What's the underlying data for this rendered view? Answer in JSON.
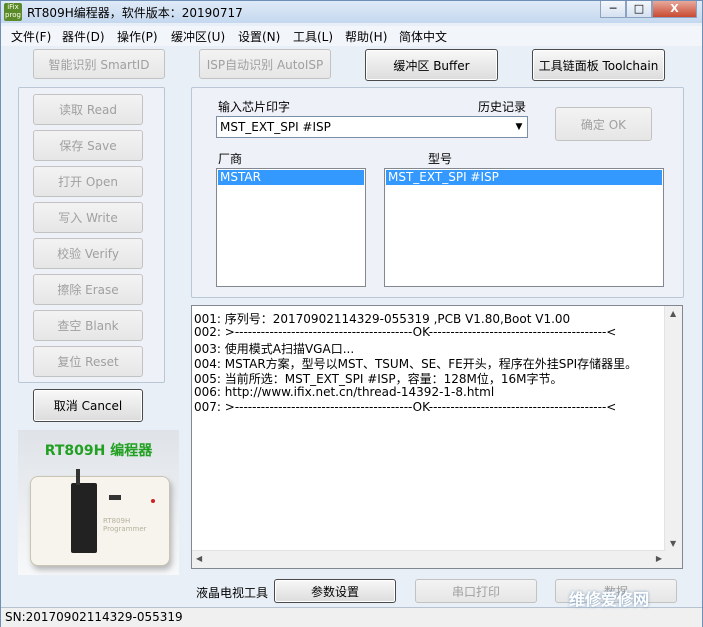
{
  "window": {
    "title": "RT809H编程器，软件版本：20190717",
    "icon_text": "iFix prog",
    "controls": [
      "─",
      "□",
      "X"
    ]
  },
  "menu": [
    "文件(F)",
    "器件(D)",
    "操作(P)",
    "缓冲区(U)",
    "设置(N)",
    "工具(L)",
    "帮助(H)",
    "简体中文"
  ],
  "top_buttons": {
    "smartid": "智能识别 SmartID",
    "autoisp": "ISP自动识别 AutoISP",
    "buffer": "缓冲区 Buffer",
    "toolchain": "工具链面板 Toolchain"
  },
  "operations": [
    "读取 Read",
    "保存 Save",
    "打开 Open",
    "写入 Write",
    "校验 Verify",
    "擦除 Erase",
    "查空 Blank",
    "复位 Reset"
  ],
  "cancel_label": "取消 Cancel",
  "chip": {
    "input_label": "输入芯片印字",
    "history_label": "历史记录",
    "input_value": "MST_EXT_SPI #ISP",
    "ok_label": "确定 OK",
    "vendor_label": "厂商",
    "model_label": "型号",
    "vendor_selected": "MSTAR",
    "model_selected": "MST_EXT_SPI #ISP"
  },
  "log_lines": [
    "001: 序列号：20170902114329-055319 ,PCB V1.80,Boot V1.00",
    "002: >-----------------------------------------OK-----------------------------------------<",
    "003: 使用模式A扫描VGA口...",
    "004: MSTAR方案，型号以MST、TSUM、SE、FE开头，程序在外挂SPI存储器里。",
    "005: 当前所选：MST_EXT_SPI #ISP，容量：128M位，16M字节。",
    "006: http://www.ifix.net.cn/thread-14392-1-8.html",
    "007: >-----------------------------------------OK-----------------------------------------<"
  ],
  "photo": {
    "caption": "RT809H 编程器",
    "device_text": "RT809H Programmer"
  },
  "bottom": {
    "lcd_tools_label": "液晶电视工具",
    "params_label": "参数设置",
    "serial_print_label": "串口打印",
    "partial_button_label": "数据"
  },
  "status": {
    "serial": "SN:20170902114329-055319"
  },
  "watermark": "维修爱修网",
  "colors": {
    "selection": "#3399ff",
    "caption_green": "#22a022"
  }
}
